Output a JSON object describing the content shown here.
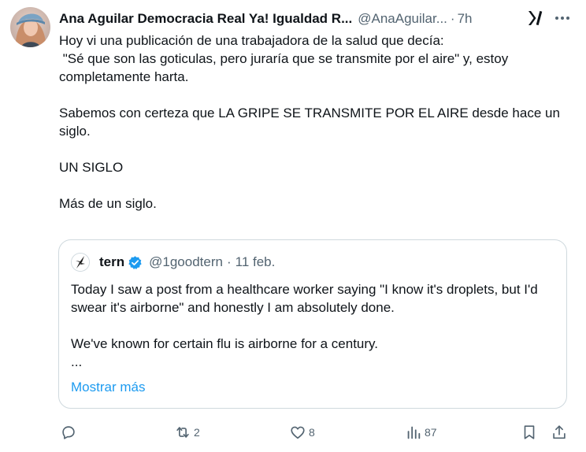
{
  "tweet": {
    "author_name": "Ana Aguilar Democracia Real Ya! Igualdad R...",
    "handle": "@AnaAguilar...",
    "separator": "·",
    "time": "7h",
    "text": {
      "p1_line1": "Hoy vi una publicación de una trabajadora de la salud que decía:",
      "p1_line2": " \"Sé que son las goticulas, pero juraría que se transmite por el aire\" y, estoy completamente harta.",
      "p2": "Sabemos con certeza que LA GRIPE SE TRANSMITE POR EL AIRE desde hace un siglo.",
      "p3": "UN SIGLO",
      "p4": "Más de un siglo."
    },
    "icons": {
      "avatar": "avatar",
      "grok": "grok-icon",
      "more": "more-icon"
    }
  },
  "quote": {
    "name": "tern",
    "handle": "@1goodtern",
    "separator": "·",
    "date": "11 feb.",
    "text": {
      "p1": "Today I saw a post from a healthcare worker saying \"I know it's droplets, but I'd swear it's airborne\" and honestly I am absolutely done.",
      "p2": "We've known for certain flu is airborne for a century.",
      "ellipsis": "..."
    },
    "show_more": "Mostrar más",
    "icons": {
      "avatar": "bird-avatar",
      "verified": "verified-badge-icon"
    }
  },
  "actions": {
    "reply": {
      "icon": "reply-icon",
      "count": ""
    },
    "repost": {
      "icon": "repost-icon",
      "count": "2"
    },
    "like": {
      "icon": "heart-icon",
      "count": "8"
    },
    "views": {
      "icon": "views-icon",
      "count": "87"
    },
    "bookmark": {
      "icon": "bookmark-icon"
    },
    "share": {
      "icon": "share-icon"
    }
  },
  "colors": {
    "text": "#0f1419",
    "secondary": "#536471",
    "accent": "#1d9bf0",
    "border": "#cfd9de",
    "background": "#ffffff"
  }
}
